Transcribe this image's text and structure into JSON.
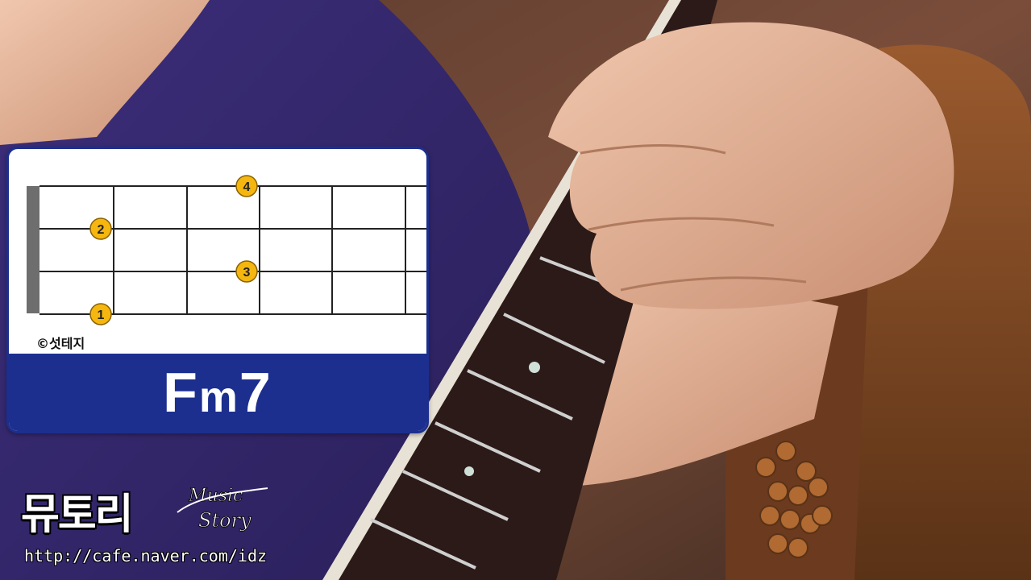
{
  "chord": {
    "name_root": "F",
    "name_quality": "m",
    "name_extension": "7",
    "copyright": "©섯테지",
    "finger_labels": [
      "1",
      "2",
      "3",
      "4"
    ]
  },
  "watermark": {
    "title": "뮤토리",
    "logo_word1": "Music",
    "logo_word2": "Story",
    "url": "http://cafe.naver.com/idz"
  },
  "colors": {
    "banner": "#1c2f8f",
    "finger_dot": "#f5b70f",
    "nut": "#6e6e6e"
  }
}
